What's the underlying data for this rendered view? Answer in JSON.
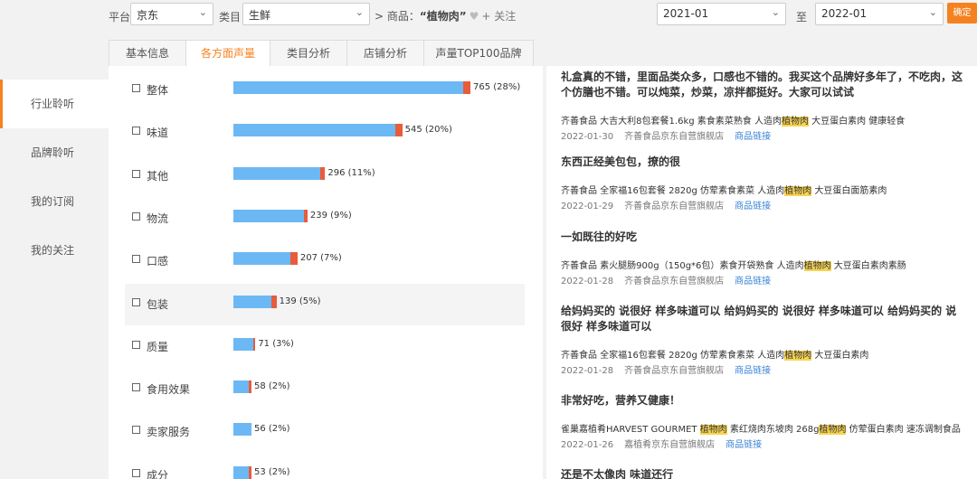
{
  "filters": {
    "platform_label": "平台",
    "platform_value": "京东",
    "category_label": "类目",
    "category_value": "生鲜",
    "product_prefix": "> 商品：",
    "product_name": "“植物肉”",
    "follow_label": "+ 关注",
    "date_from": "2021-01",
    "date_to_label": "至",
    "date_to": "2022-01",
    "confirm_label": "确定"
  },
  "tabs": [
    "基本信息",
    "各方面声量",
    "类目分析",
    "店铺分析",
    "声量TOP100品牌"
  ],
  "active_tab": 1,
  "nav": [
    "行业聆听",
    "品牌聆听",
    "我的订阅",
    "我的关注"
  ],
  "active_nav": 0,
  "accent_color": "#f58220",
  "chart_data": {
    "type": "bar",
    "orientation": "horizontal",
    "categories": [
      "整体",
      "味道",
      "其他",
      "物流",
      "口感",
      "包装",
      "质量",
      "食用效果",
      "卖家服务",
      "成分"
    ],
    "values": [
      765,
      545,
      296,
      239,
      207,
      139,
      71,
      58,
      56,
      53
    ],
    "value_labels": [
      "765 (28%)",
      "545 (20%)",
      "296 (11%)",
      "239 (9%)",
      "207 (7%)",
      "139 (5%)",
      "71 (3%)",
      "58 (2%)",
      "56 (2%)",
      "53 (2%)"
    ],
    "negative_share": [
      0.03,
      0.03,
      0.02,
      0.015,
      0.03,
      0.02,
      0.01,
      0.01,
      0,
      0.01
    ],
    "highlight_index": 5,
    "colors": {
      "bar": "#6cb8f5",
      "negative": "#e85c3c"
    }
  },
  "reviews": [
    {
      "text": "礼盒真的不错，里面品类众多，口感也不错的。我买这个品牌好多年了，不吃肉，这个仿膳也不错。可以炖菜，炒菜，凉拌都挺好。大家可以试试",
      "product_parts": [
        "齐善食品 大吉大利8包套餐1.6kg 素食素菜熟食 人造肉",
        "植物肉",
        " 大豆蛋白素肉 健康轻食"
      ],
      "date": "2022-01-30",
      "shop": "齐善食品京东自营旗舰店",
      "link": "商品链接"
    },
    {
      "text": "东西正经美包包，撩的很",
      "product_parts": [
        "齐善食品 全家福16包套餐 2820g 仿荤素食素菜 人造肉",
        "植物肉",
        " 大豆蛋白面筋素肉"
      ],
      "date": "2022-01-29",
      "shop": "齐善食品京东自营旗舰店",
      "link": "商品链接"
    },
    {
      "text": "一如既往的好吃",
      "product_parts": [
        "齐善食品 素火腿肠900g（150g*6包）素食开袋熟食 人造肉",
        "植物肉",
        " 大豆蛋白素肉素肠"
      ],
      "date": "2022-01-28",
      "shop": "齐善食品京东自营旗舰店",
      "link": "商品链接"
    },
    {
      "text": "给妈妈买的 说很好 样多味道可以 给妈妈买的 说很好 样多味道可以 给妈妈买的 说很好 样多味道可以",
      "product_parts": [
        "齐善食品 全家福16包套餐 2820g 仿荤素食素菜 人造肉",
        "植物肉",
        " 大豆蛋白素肉"
      ],
      "date": "2022-01-28",
      "shop": "齐善食品京东自营旗舰店",
      "link": "商品链接"
    },
    {
      "text": "非常好吃，营养又健康！",
      "product_parts": [
        "雀巢嘉植肴HARVEST GOURMET ",
        "植物肉",
        " 素红烧肉东坡肉 268g",
        "植物肉",
        " 仿荤蛋白素肉 速冻调制食品"
      ],
      "date": "2022-01-26",
      "shop": "嘉植肴京东自营旗舰店",
      "link": "商品链接"
    },
    {
      "text": "还是不太像肉 味道还行"
    }
  ]
}
